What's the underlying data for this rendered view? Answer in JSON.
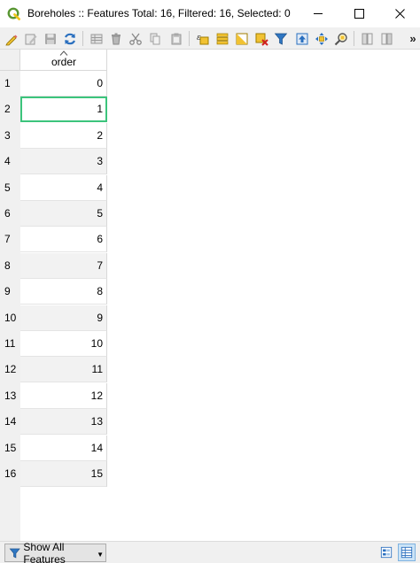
{
  "window": {
    "title": "Boreholes :: Features Total: 16, Filtered: 16, Selected: 0",
    "app_icon": "qgis-logo-icon",
    "controls": [
      "minimize-icon",
      "maximize-icon",
      "close-icon"
    ]
  },
  "toolbar": {
    "items": [
      "toggle-editing-icon",
      "multi-edit-icon",
      "save-edits-icon",
      "reload-icon",
      "add-feature-icon",
      "delete-feature-icon",
      "cut-icon",
      "copy-icon",
      "paste-icon",
      "expression-select-icon",
      "select-all-icon",
      "invert-selection-icon",
      "deselect-icon",
      "filter-selection-icon",
      "move-selection-top-icon",
      "pan-to-selection-icon",
      "zoom-to-selection-icon",
      "new-field-icon",
      "delete-field-icon"
    ],
    "overflow_label": "»"
  },
  "table": {
    "column_header": "order",
    "current_row_index": 1,
    "rows": [
      {
        "num": "1",
        "value": "0"
      },
      {
        "num": "2",
        "value": "1"
      },
      {
        "num": "3",
        "value": "2"
      },
      {
        "num": "4",
        "value": "3"
      },
      {
        "num": "5",
        "value": "4"
      },
      {
        "num": "6",
        "value": "5"
      },
      {
        "num": "7",
        "value": "6"
      },
      {
        "num": "8",
        "value": "7"
      },
      {
        "num": "9",
        "value": "8"
      },
      {
        "num": "10",
        "value": "9"
      },
      {
        "num": "11",
        "value": "10"
      },
      {
        "num": "12",
        "value": "11"
      },
      {
        "num": "13",
        "value": "12"
      },
      {
        "num": "14",
        "value": "13"
      },
      {
        "num": "15",
        "value": "14"
      },
      {
        "num": "16",
        "value": "15"
      }
    ]
  },
  "statusbar": {
    "filter_button_label": "Show All Features",
    "view_modes": [
      "form-view-icon",
      "table-view-icon"
    ],
    "active_view": "table-view-icon"
  },
  "colors": {
    "current_cell_border": "#3cc47c",
    "qgis_green": "#589632",
    "qgis_yellow": "#f0c419"
  }
}
